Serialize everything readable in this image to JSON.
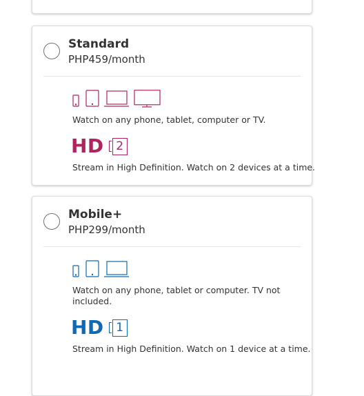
{
  "plans": {
    "standard": {
      "name": "Standard",
      "price": "PHP459/month",
      "devices": [
        "phone-icon",
        "tablet-icon",
        "laptop-icon",
        "tv-icon"
      ],
      "devices_text": "Watch on any phone, tablet, computer or TV.",
      "resolution": "HD",
      "screens": "2",
      "stream_text": "Stream in High Definition. Watch on 2 devices at a time.",
      "selected": false,
      "accent_color": "#b1235e"
    },
    "mobile_plus": {
      "name": "Mobile+",
      "price": "PHP299/month",
      "devices": [
        "phone-icon",
        "tablet-icon",
        "laptop-icon"
      ],
      "devices_text": "Watch on any phone, tablet or computer. TV not included.",
      "resolution": "HD",
      "screens": "1",
      "stream_text": "Stream in High Definition. Watch on 1 device at a time.",
      "selected": false,
      "accent_color": "#0f69b4"
    }
  },
  "colors": {
    "text": "#333333",
    "border": "#dddddd",
    "radio_border": "#707070"
  }
}
